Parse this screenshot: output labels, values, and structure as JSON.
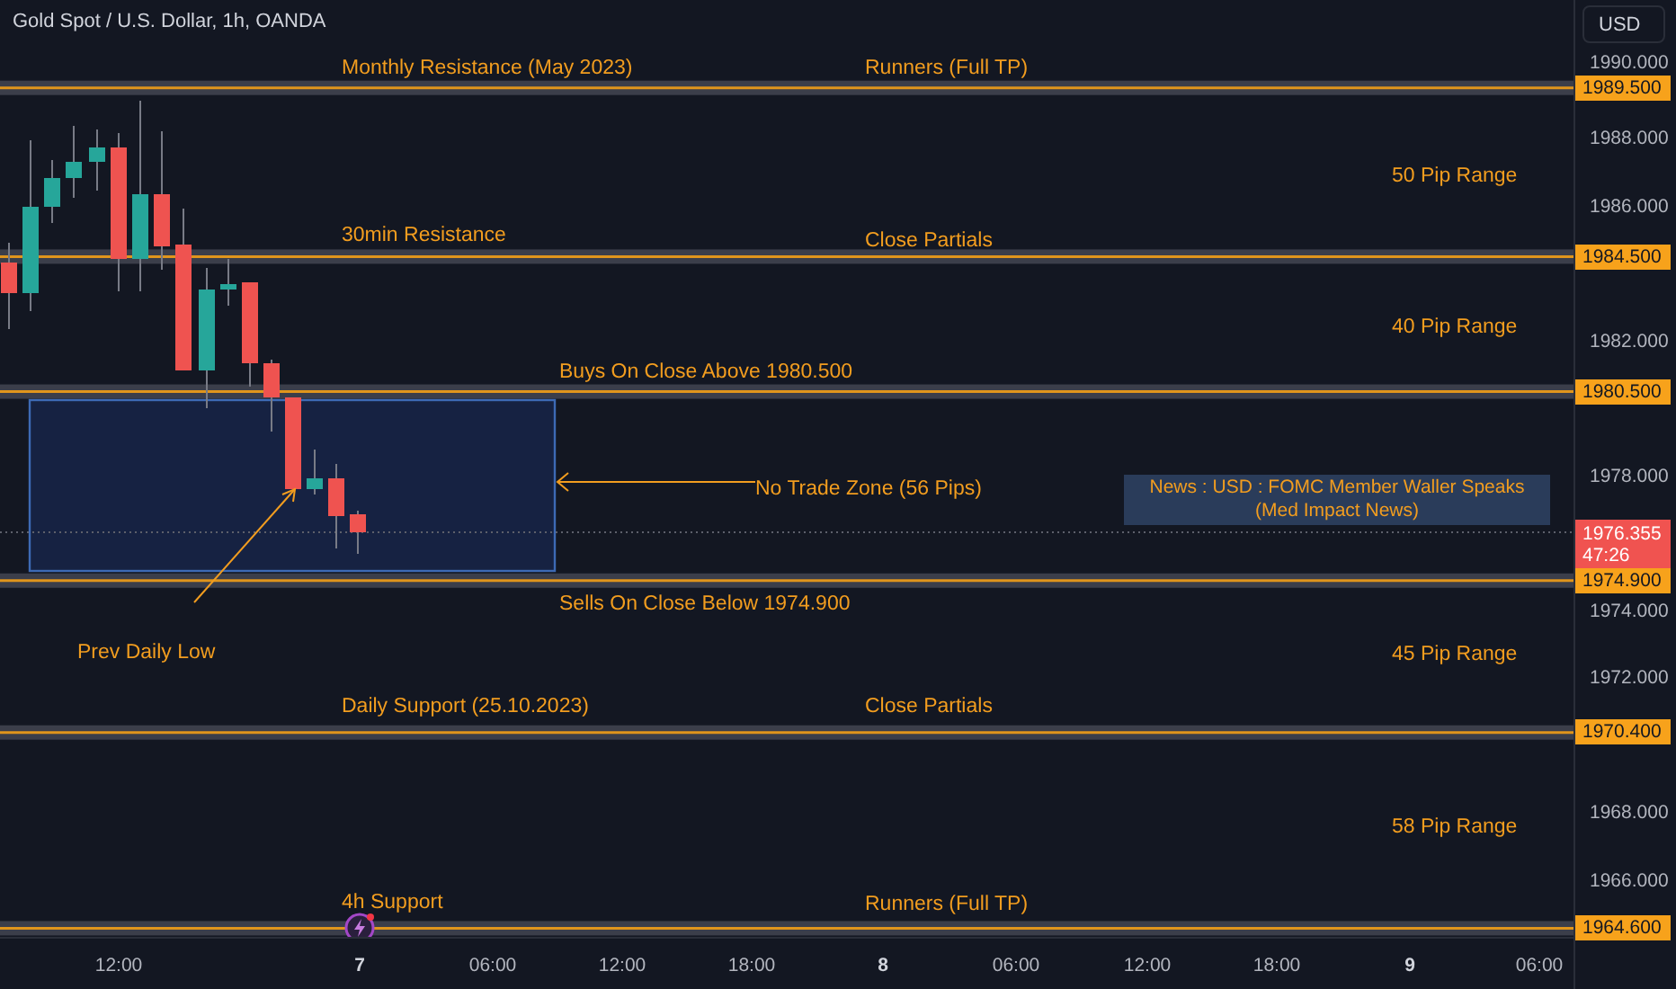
{
  "header": {
    "symbol_title": "Gold Spot / U.S. Dollar, 1h, OANDA",
    "currency_button": "USD"
  },
  "annotations": [
    "Monthly Resistance (May 2023)",
    "Runners (Full TP)",
    "50 Pip Range",
    "30min Resistance",
    "Close Partials",
    "40 Pip Range",
    "Buys On Close Above 1980.500",
    "No Trade Zone (56 Pips)",
    "Sells On Close Below 1974.900",
    "Prev Daily Low",
    "45 Pip Range",
    "Daily Support (25.10.2023)",
    "Close Partials",
    "58 Pip Range",
    "4h Support",
    "Runners (Full TP)"
  ],
  "news": {
    "lines": [
      "News : USD : FOMC Member Waller Speaks",
      "(Med Impact News)"
    ]
  },
  "price_axis": {
    "ticks": [
      "1990.000",
      "1988.000",
      "1986.000",
      "1982.000",
      "1978.000",
      "1974.000",
      "1972.000",
      "1968.000",
      "1966.000"
    ],
    "last_price": "1976.355",
    "countdown": "47:26"
  },
  "levels": [
    "1989.500",
    "1984.500",
    "1980.500",
    "1974.900",
    "1970.400",
    "1964.600"
  ],
  "time_axis": [
    "12:00",
    "7",
    "06:00",
    "12:00",
    "18:00",
    "8",
    "06:00",
    "12:00",
    "18:00",
    "9",
    "06:00"
  ]
}
